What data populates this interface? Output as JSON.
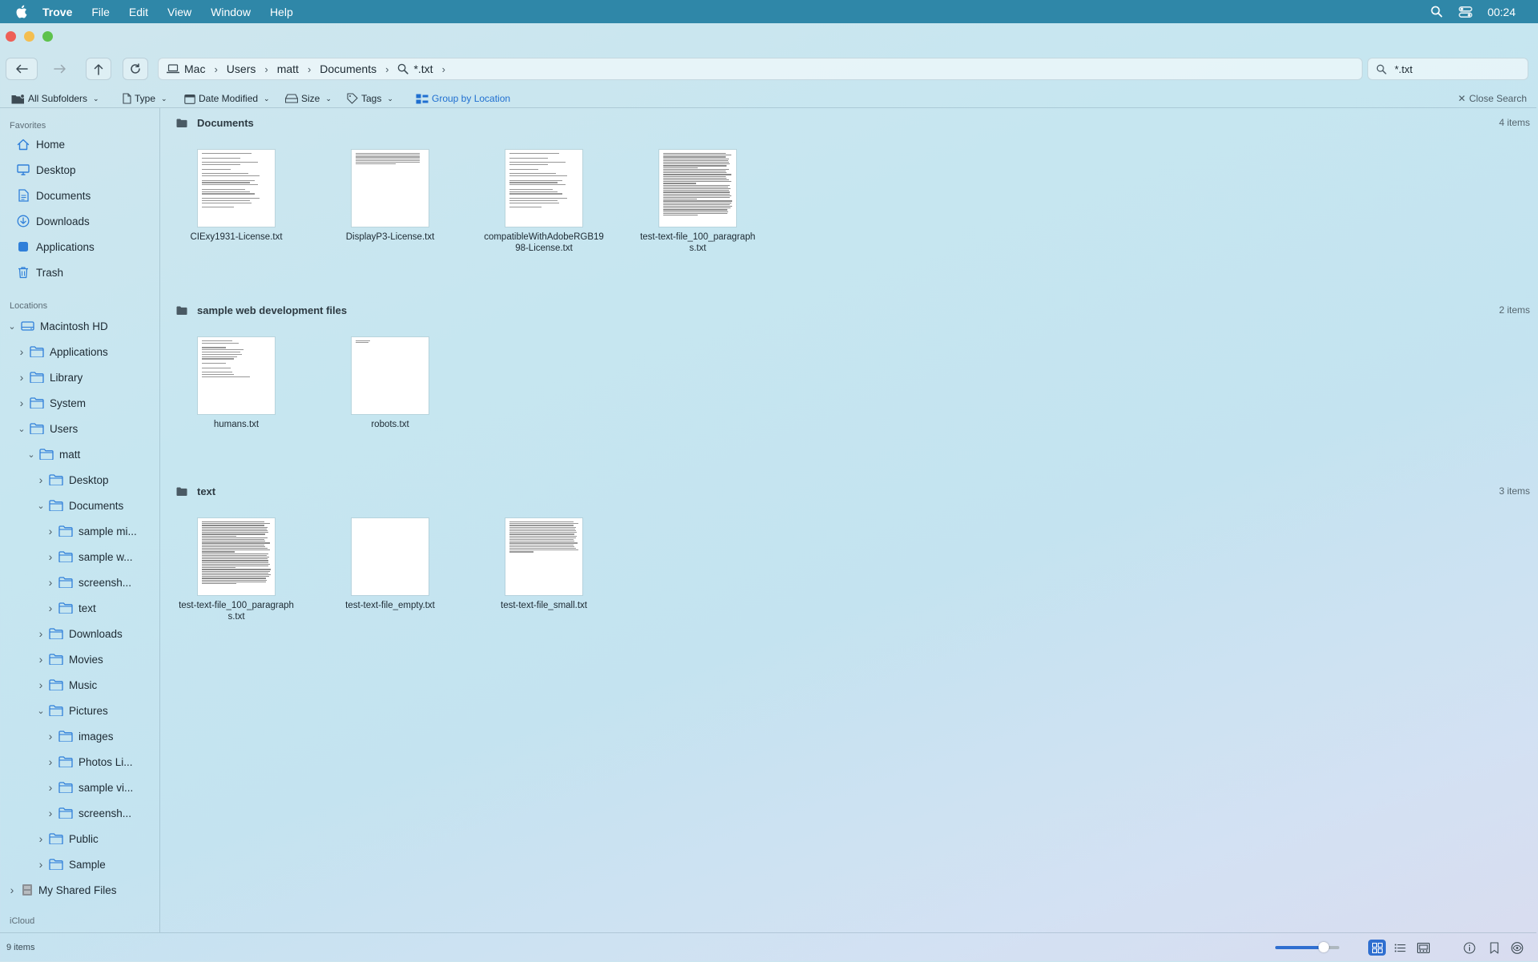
{
  "menubar": {
    "app": "Trove",
    "items": [
      "File",
      "Edit",
      "View",
      "Window",
      "Help"
    ],
    "clock": "00:24"
  },
  "toolbar": {
    "path": [
      "Mac",
      "Users",
      "matt",
      "Documents",
      "*.txt"
    ],
    "search_value": "*.txt"
  },
  "filters": {
    "subfolders": "All Subfolders",
    "type": "Type",
    "date_modified": "Date Modified",
    "size": "Size",
    "tags": "Tags",
    "group_by": "Group by Location",
    "close_search": "Close Search"
  },
  "sidebar": {
    "favorites_header": "Favorites",
    "favorites": [
      {
        "label": "Home",
        "icon": "home-icon"
      },
      {
        "label": "Desktop",
        "icon": "desktop-icon"
      },
      {
        "label": "Documents",
        "icon": "document-icon"
      },
      {
        "label": "Downloads",
        "icon": "download-icon"
      },
      {
        "label": "Applications",
        "icon": "applications-icon"
      },
      {
        "label": "Trash",
        "icon": "trash-icon"
      }
    ],
    "locations_header": "Locations",
    "tree": [
      {
        "label": "Macintosh HD",
        "level": 0,
        "state": "open",
        "icon": "drive-icon"
      },
      {
        "label": "Applications",
        "level": 1,
        "state": "closed",
        "icon": "folder-icon"
      },
      {
        "label": "Library",
        "level": 1,
        "state": "closed",
        "icon": "folder-icon"
      },
      {
        "label": "System",
        "level": 1,
        "state": "closed",
        "icon": "folder-icon"
      },
      {
        "label": "Users",
        "level": 1,
        "state": "open",
        "icon": "folder-icon"
      },
      {
        "label": "matt",
        "level": 2,
        "state": "open",
        "icon": "folder-icon"
      },
      {
        "label": "Desktop",
        "level": 3,
        "state": "closed",
        "icon": "folder-icon"
      },
      {
        "label": "Documents",
        "level": 3,
        "state": "open",
        "icon": "folder-icon"
      },
      {
        "label": "sample mi...",
        "level": 4,
        "state": "closed",
        "icon": "folder-icon"
      },
      {
        "label": "sample w...",
        "level": 4,
        "state": "closed",
        "icon": "folder-icon"
      },
      {
        "label": "screensh...",
        "level": 4,
        "state": "closed",
        "icon": "folder-icon"
      },
      {
        "label": "text",
        "level": 4,
        "state": "closed",
        "icon": "folder-icon"
      },
      {
        "label": "Downloads",
        "level": 3,
        "state": "closed",
        "icon": "folder-icon"
      },
      {
        "label": "Movies",
        "level": 3,
        "state": "closed",
        "icon": "folder-icon"
      },
      {
        "label": "Music",
        "level": 3,
        "state": "closed",
        "icon": "folder-icon"
      },
      {
        "label": "Pictures",
        "level": 3,
        "state": "open",
        "icon": "folder-icon"
      },
      {
        "label": "images",
        "level": 4,
        "state": "closed",
        "icon": "folder-icon"
      },
      {
        "label": "Photos Li...",
        "level": 4,
        "state": "closed",
        "icon": "folder-icon"
      },
      {
        "label": "sample vi...",
        "level": 4,
        "state": "closed",
        "icon": "folder-icon"
      },
      {
        "label": "screensh...",
        "level": 4,
        "state": "closed",
        "icon": "folder-icon"
      },
      {
        "label": "Public",
        "level": 3,
        "state": "closed",
        "icon": "folder-icon"
      },
      {
        "label": "Sample",
        "level": 3,
        "state": "closed",
        "icon": "folder-icon"
      },
      {
        "label": "My Shared Files",
        "level": 0,
        "state": "closed",
        "icon": "shared-drive-icon"
      }
    ],
    "icloud_header": "iCloud"
  },
  "groups": [
    {
      "title": "Documents",
      "count": "4 items",
      "files": [
        {
          "name": "CIExy1931-License.txt",
          "density": "sparse"
        },
        {
          "name": "DisplayP3-License.txt",
          "density": "short"
        },
        {
          "name": "compatibleWithAdobeRGB1998-License.txt",
          "density": "sparse"
        },
        {
          "name": "test-text-file_100_paragraphs.txt",
          "density": "dense"
        }
      ]
    },
    {
      "title": "sample web development files",
      "count": "2 items",
      "files": [
        {
          "name": "humans.txt",
          "density": "list"
        },
        {
          "name": "robots.txt",
          "density": "tiny"
        }
      ]
    },
    {
      "title": "text",
      "count": "3 items",
      "files": [
        {
          "name": "test-text-file_100_paragraphs.txt",
          "density": "dense"
        },
        {
          "name": "test-text-file_empty.txt",
          "density": "empty"
        },
        {
          "name": "test-text-file_small.txt",
          "density": "half"
        }
      ]
    }
  ],
  "status": {
    "count": "9 items",
    "zoom": 0.75
  }
}
